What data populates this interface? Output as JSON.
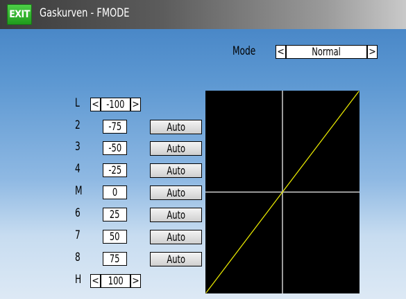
{
  "header": {
    "exit_label": "EXIT",
    "title": "Gaskurven - FMODE"
  },
  "mode": {
    "label": "Mode",
    "value": "Normal",
    "prev": "<",
    "next": ">"
  },
  "points": [
    {
      "label": "L",
      "value": "-100",
      "auto": null
    },
    {
      "label": "2",
      "value": "-75",
      "auto": "Auto"
    },
    {
      "label": "3",
      "value": "-50",
      "auto": "Auto"
    },
    {
      "label": "4",
      "value": "-25",
      "auto": "Auto"
    },
    {
      "label": "M",
      "value": "0",
      "auto": "Auto"
    },
    {
      "label": "6",
      "value": "25",
      "auto": "Auto"
    },
    {
      "label": "7",
      "value": "50",
      "auto": "Auto"
    },
    {
      "label": "8",
      "value": "75",
      "auto": "Auto"
    },
    {
      "label": "H",
      "value": "100",
      "auto": null
    }
  ],
  "colors": {
    "curve": "#e6e600",
    "graph_bg": "#000000",
    "axes": "#d0d0d0",
    "exit": "#2fb52a"
  },
  "chart_data": {
    "type": "line",
    "x": [
      -100,
      -75,
      -50,
      -25,
      0,
      25,
      50,
      75,
      100
    ],
    "y": [
      -100,
      -75,
      -50,
      -25,
      0,
      25,
      50,
      75,
      100
    ],
    "xlim": [
      -100,
      100
    ],
    "ylim": [
      -100,
      100
    ]
  }
}
